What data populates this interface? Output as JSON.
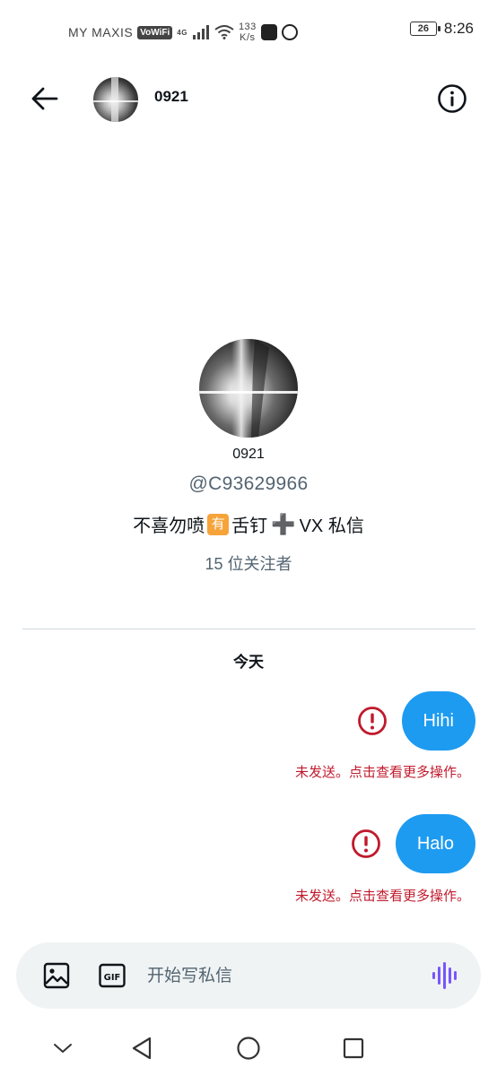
{
  "status_bar": {
    "carrier": "MY MAXIS",
    "vowifi": "VoWiFi",
    "network": "4G",
    "speed_value": "133",
    "speed_unit": "K/s",
    "battery": "26",
    "time": "8:26"
  },
  "header": {
    "title": "0921"
  },
  "profile": {
    "name": "0921",
    "handle": "@C93629966",
    "bio_part1": "不喜勿喷",
    "bio_emoji": "有",
    "bio_part2": "舌钉",
    "bio_part3": "VX 私信",
    "followers": "15 位关注者"
  },
  "conversation": {
    "date_label": "今天",
    "messages": [
      {
        "text": "Hihi",
        "status": "未发送。点击查看更多操作。"
      },
      {
        "text": "Halo",
        "status": "未发送。点击查看更多操作。"
      }
    ]
  },
  "composer": {
    "placeholder": "开始写私信",
    "gif_label": "GIF"
  },
  "colors": {
    "accent": "#1d9bf0",
    "error": "#c01a2c",
    "voice": "#7856ff",
    "emoji_bg": "#f6a33a"
  }
}
